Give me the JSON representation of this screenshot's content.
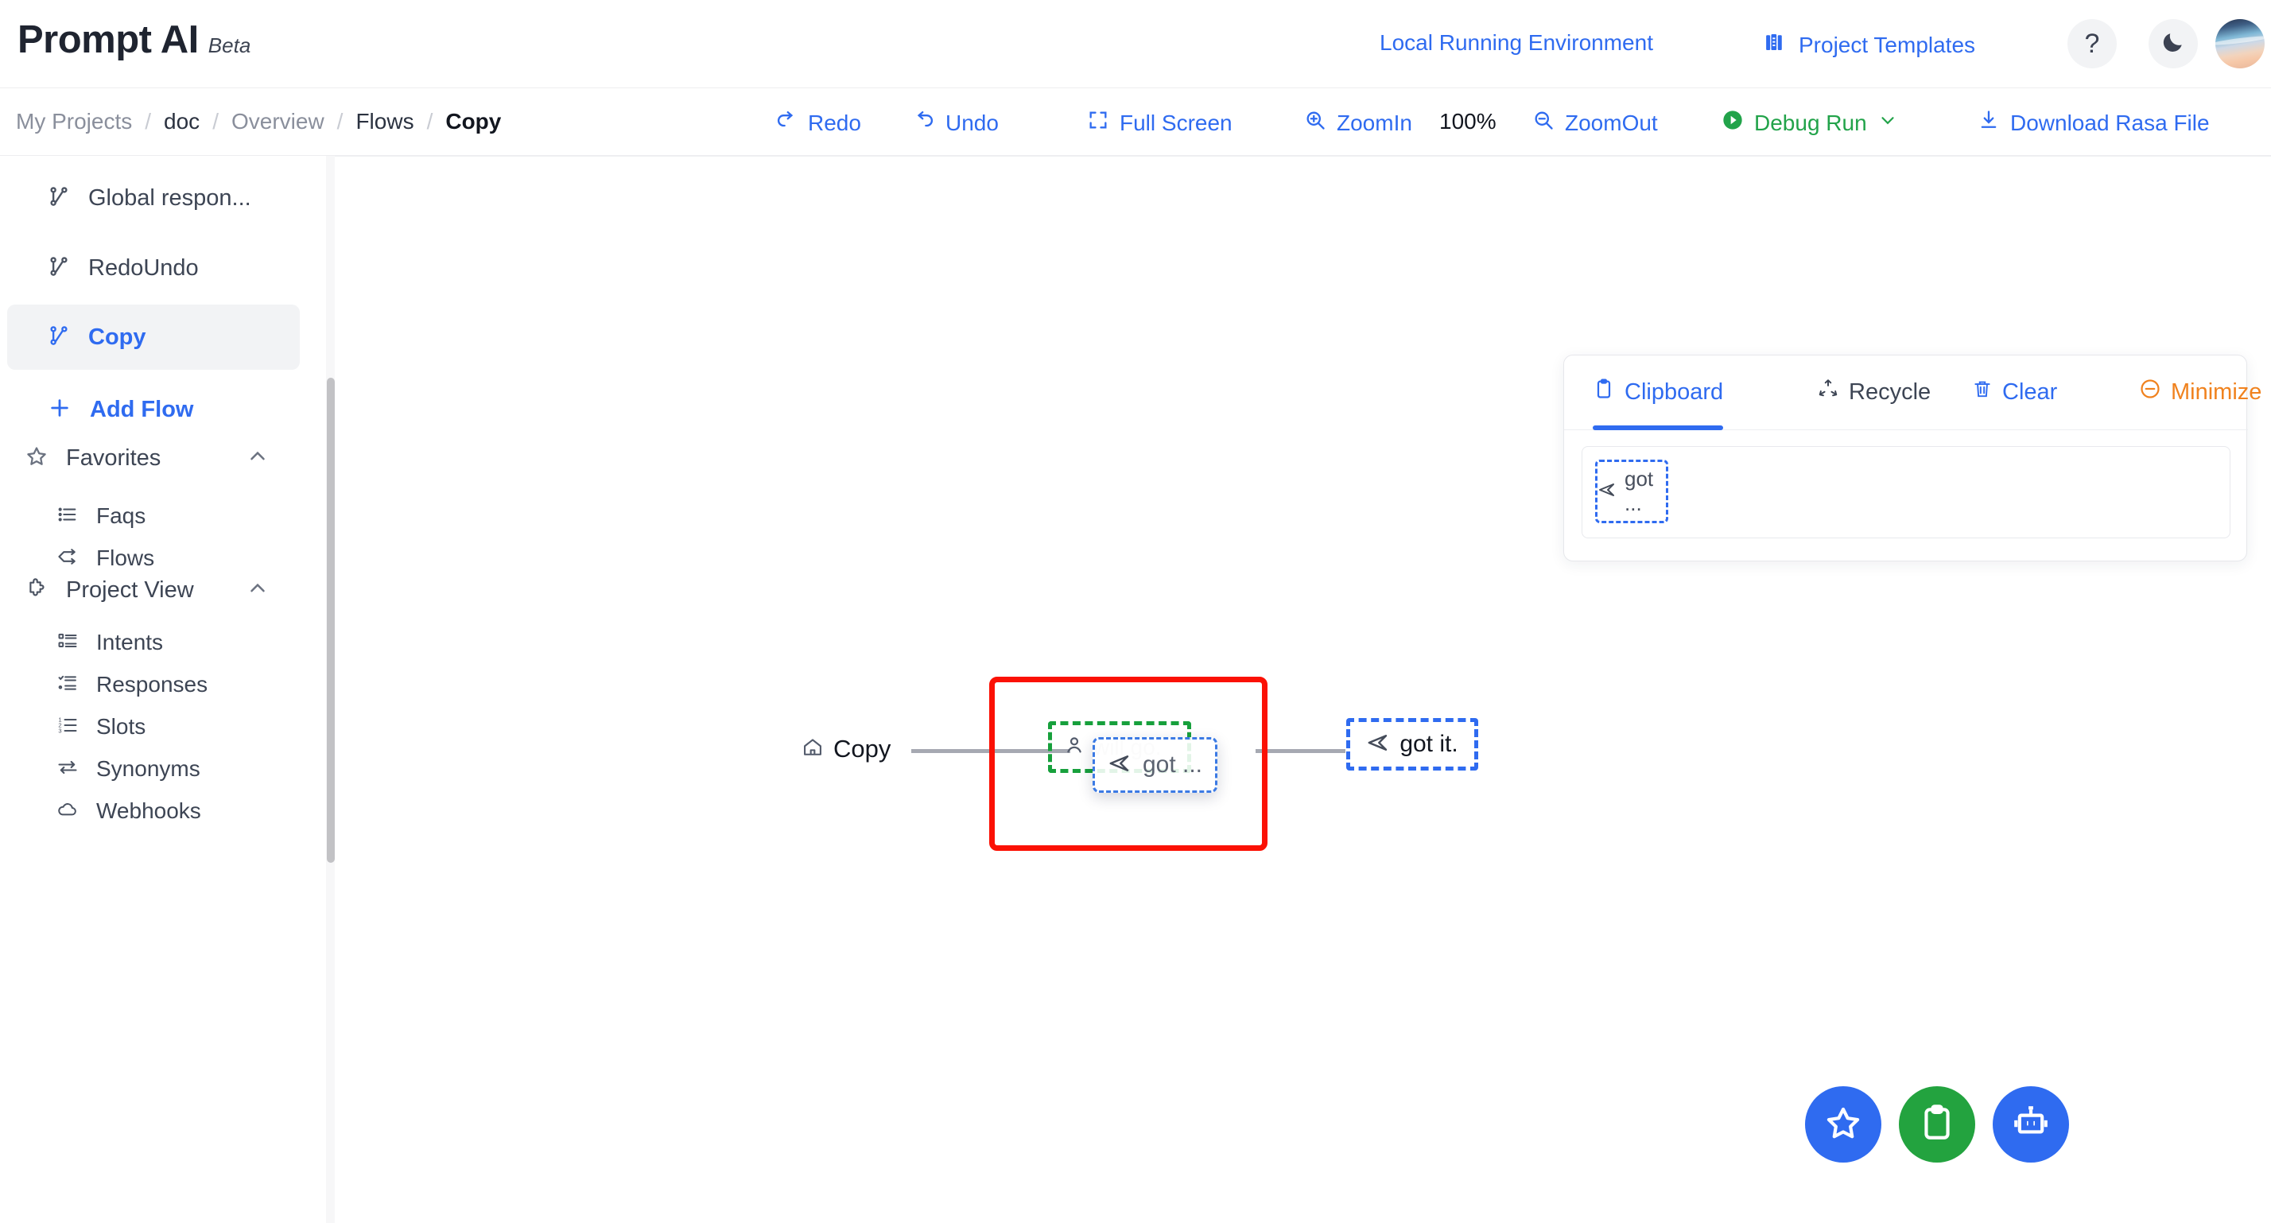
{
  "header": {
    "brand_name": "Prompt AI",
    "brand_tag": "Beta",
    "env_link": "Local Running Environment",
    "templates_link": "Project Templates",
    "help_glyph": "?",
    "icons": {
      "templates": "books-icon",
      "help": "question-mark-icon",
      "theme": "moon-icon",
      "avatar": "user-avatar"
    }
  },
  "toolbar": {
    "breadcrumb": [
      {
        "label": "My Projects",
        "style": "muted"
      },
      {
        "label": "doc",
        "style": "dark"
      },
      {
        "label": "Overview",
        "style": "muted"
      },
      {
        "label": "Flows",
        "style": "dark"
      },
      {
        "label": "Copy",
        "style": "current"
      }
    ],
    "separator": "/",
    "redo": "Redo",
    "undo": "Undo",
    "full_screen": "Full Screen",
    "zoom_in": "ZoomIn",
    "zoom_level": "100%",
    "zoom_out": "ZoomOut",
    "debug_run": "Debug Run",
    "download": "Download Rasa File"
  },
  "sidebar": {
    "flows": [
      {
        "label": "Global respon...",
        "icon": "git-branch-icon",
        "state": "normal"
      },
      {
        "label": "RedoUndo",
        "icon": "git-branch-icon",
        "state": "normal"
      },
      {
        "label": "Copy",
        "icon": "git-branch-icon",
        "state": "active"
      }
    ],
    "add_flow": "Add Flow",
    "groups": [
      {
        "label": "Favorites",
        "icon": "star-outline-icon",
        "expanded": true,
        "items": [
          {
            "label": "Faqs",
            "icon": "list-detail-icon"
          },
          {
            "label": "Flows",
            "icon": "flow-branch-icon"
          }
        ]
      },
      {
        "label": "Project View",
        "icon": "puzzle-piece-icon",
        "expanded": true,
        "items": [
          {
            "label": "Intents",
            "icon": "list-boxes-icon"
          },
          {
            "label": "Responses",
            "icon": "list-check-icon"
          },
          {
            "label": "Slots",
            "icon": "list-numbered-icon"
          },
          {
            "label": "Synonyms",
            "icon": "arrows-swap-icon"
          },
          {
            "label": "Webhooks",
            "icon": "cloud-icon"
          }
        ]
      }
    ]
  },
  "canvas": {
    "start_node": {
      "label": "Copy",
      "icon": "home-icon"
    },
    "user_node": {
      "label": "will go.",
      "icon": "person-icon"
    },
    "drag_ghost": {
      "label": "got ...",
      "icon": "send-icon"
    },
    "bot_node": {
      "label": "got it.",
      "icon": "send-icon"
    },
    "selection_color": "#fb1105",
    "user_node_border_color": "#17a03c",
    "bot_node_border_color": "#2f6bf0"
  },
  "clipboard_panel": {
    "tabs": [
      {
        "label": "Clipboard",
        "icon": "clipboard-icon",
        "active": true
      },
      {
        "label": "Recycle",
        "icon": "recycle-icon",
        "active": false
      },
      {
        "label": "Clear",
        "icon": "trash-icon",
        "active": false
      },
      {
        "label": "Minimize",
        "icon": "minus-circle-icon",
        "active": false
      }
    ],
    "item": {
      "label": "got ...",
      "icon": "send-icon"
    }
  },
  "fabs": [
    {
      "name": "favorite",
      "icon": "star-icon",
      "color": "#2f6bf0"
    },
    {
      "name": "clipboard",
      "icon": "clipboard-icon",
      "color": "#23a33f"
    },
    {
      "name": "bot",
      "icon": "robot-icon",
      "color": "#2f6bf0"
    }
  ]
}
